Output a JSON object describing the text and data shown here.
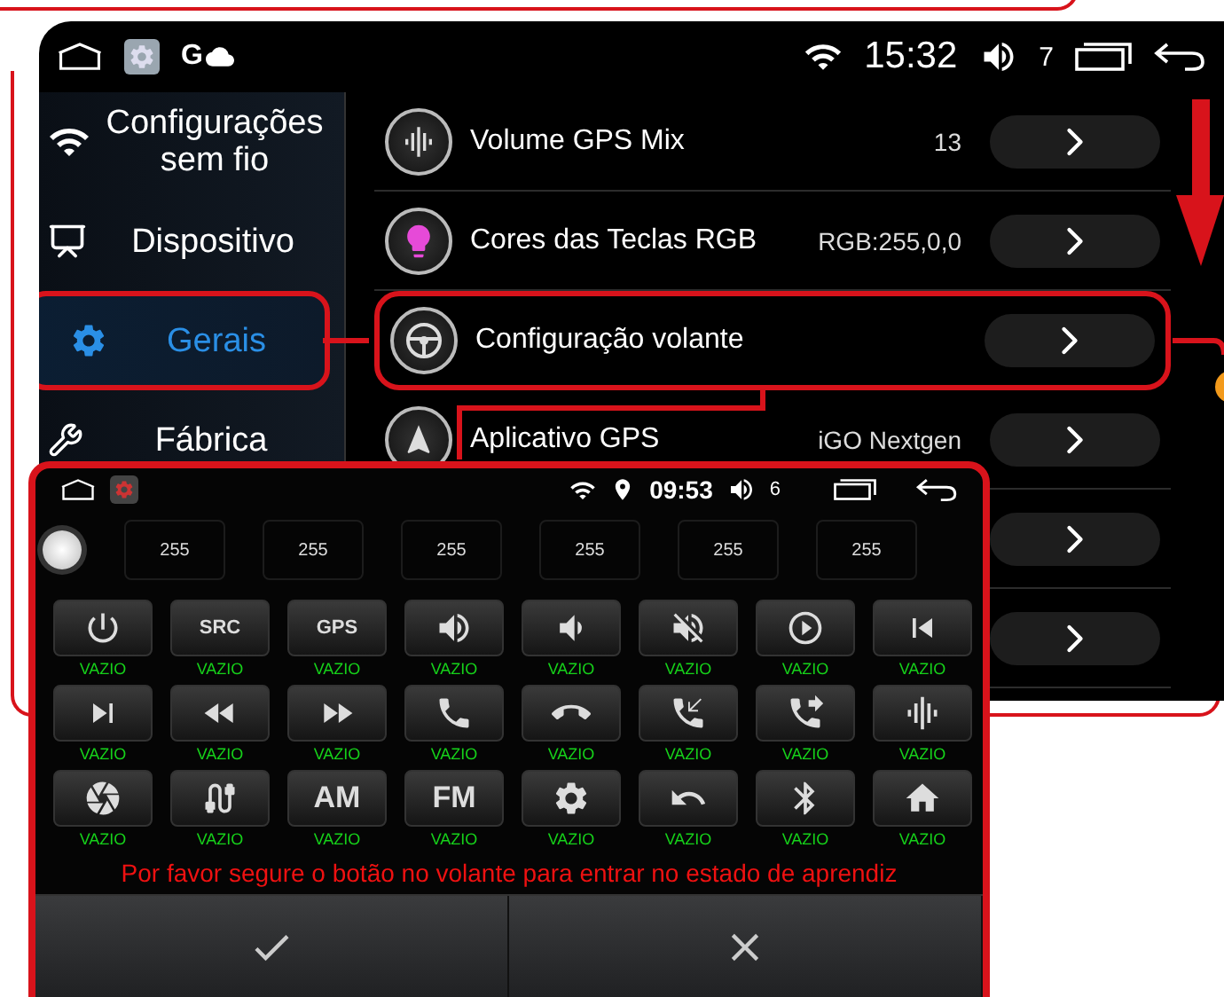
{
  "main_screen": {
    "status_bar": {
      "app_letter": "G",
      "time": "15:32",
      "volume": "7"
    },
    "sidebar": {
      "items": [
        {
          "label": "Configurações sem fio",
          "selected": false,
          "annotated": false
        },
        {
          "label": "Dispositivo",
          "selected": false,
          "annotated": false
        },
        {
          "label": "Gerais",
          "selected": true,
          "annotated": true
        },
        {
          "label": "Fábrica",
          "selected": false,
          "annotated": false
        }
      ]
    },
    "settings": [
      {
        "label": "Volume GPS Mix",
        "value": "13",
        "annotated": false
      },
      {
        "label": "Cores das Teclas RGB",
        "value": "RGB:255,0,0",
        "annotated": false
      },
      {
        "label": "Configuração volante",
        "annotated": true
      },
      {
        "label": "Aplicativo GPS",
        "value": "iGO Nextgen",
        "annotated": false
      },
      {
        "annotated": false
      },
      {
        "annotated": false
      }
    ]
  },
  "steering_dialog": {
    "status_bar": {
      "time": "09:53",
      "volume": "6"
    },
    "codes": [
      "255",
      "255",
      "255",
      "255",
      "255",
      "255"
    ],
    "keys": [
      {
        "label": "VAZIO"
      },
      {
        "text": "SRC",
        "label": "VAZIO"
      },
      {
        "text": "GPS",
        "label": "VAZIO"
      },
      {
        "label": "VAZIO"
      },
      {
        "label": "VAZIO"
      },
      {
        "label": "VAZIO"
      },
      {
        "label": "VAZIO"
      },
      {
        "label": "VAZIO"
      },
      {
        "label": "VAZIO"
      },
      {
        "label": "VAZIO"
      },
      {
        "label": "VAZIO"
      },
      {
        "label": "VAZIO"
      },
      {
        "label": "VAZIO"
      },
      {
        "label": "VAZIO"
      },
      {
        "label": "VAZIO"
      },
      {
        "label": "VAZIO"
      },
      {
        "label": "VAZIO"
      },
      {
        "label": "VAZIO"
      },
      {
        "text": "AM",
        "label": "VAZIO"
      },
      {
        "text": "FM",
        "label": "VAZIO"
      },
      {
        "label": "VAZIO"
      },
      {
        "label": "VAZIO"
      },
      {
        "label": "VAZIO"
      },
      {
        "label": "VAZIO"
      }
    ],
    "message": "Por favor segure o botão no volante para entrar no estado de aprendiz"
  }
}
